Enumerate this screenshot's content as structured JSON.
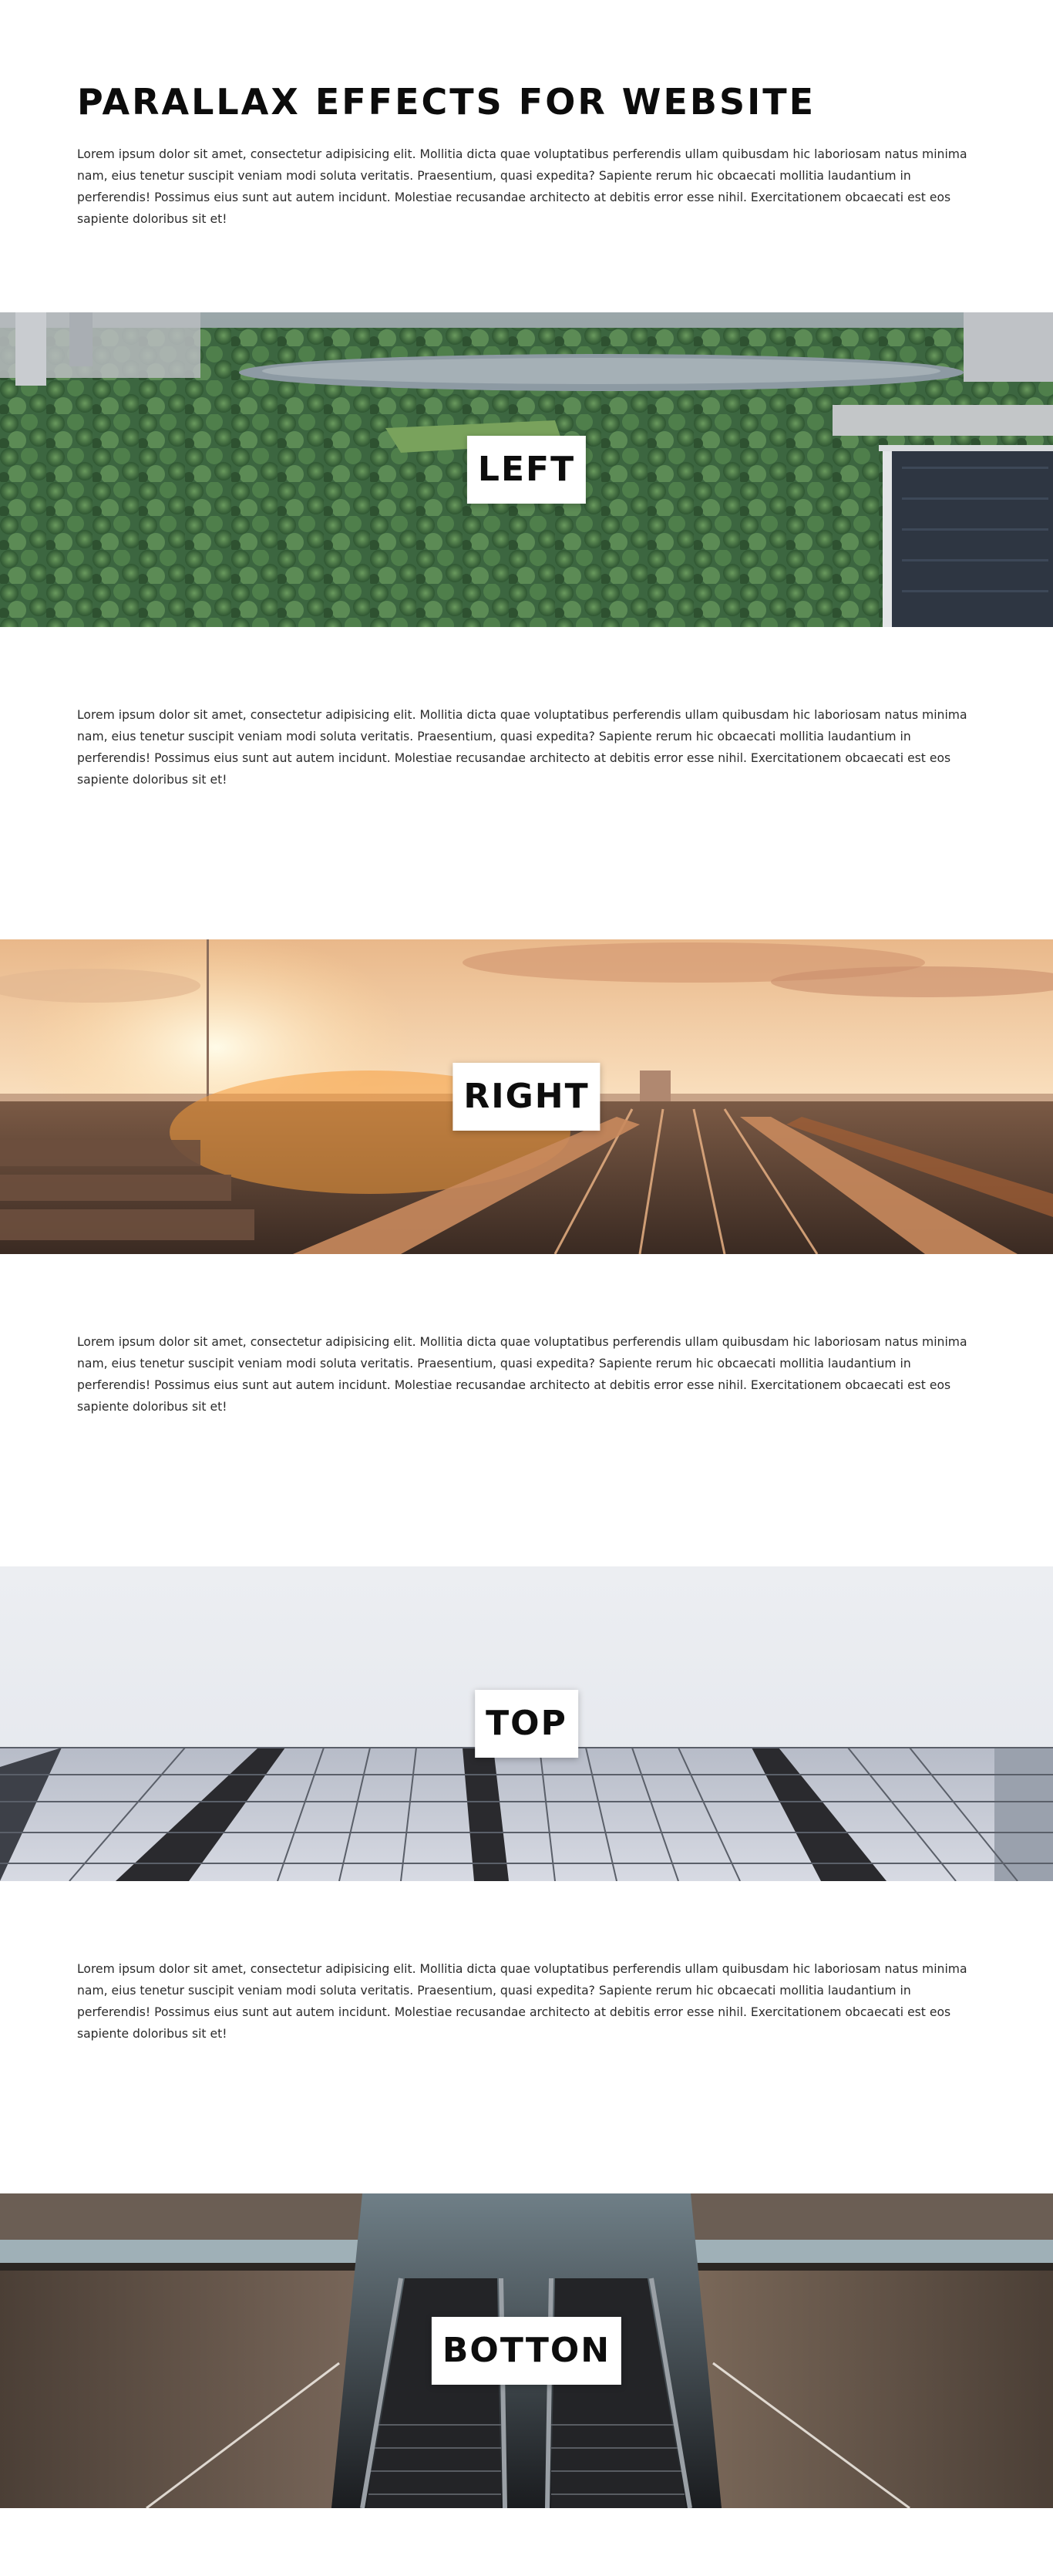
{
  "page": {
    "title": "PARALLAX EFFECTS FOR WEBSITE",
    "paragraph": "Lorem ipsum dolor sit amet, consectetur adipisicing elit. Mollitia dicta quae voluptatibus perferendis ullam quibusdam hic laboriosam natus minima nam, eius tenetur suscipit veniam modi soluta veritatis. Praesentium, quasi expedita? Sapiente rerum hic obcaecati mollitia laudantium in perferendis! Possimus eius sunt aut autem incidunt. Molestiae recusandae architecto at debitis error esse nihil. Exercitationem obcaecati est eos sapiente doloribus sit et!"
  },
  "sections": [
    {
      "label": "LEFT",
      "image": "city-park-aerial-image",
      "accent": "#3f6b3c"
    },
    {
      "label": "RIGHT",
      "image": "rail-yard-sunset-image",
      "accent": "#e98a2e"
    },
    {
      "label": "TOP",
      "image": "glass-building-sky-image",
      "accent": "#c8cdd8"
    },
    {
      "label": "BOTTON",
      "image": "escalator-station-image",
      "accent": "#3a2f28"
    }
  ],
  "paragraphs": [
    "Lorem ipsum dolor sit amet, consectetur adipisicing elit. Mollitia dicta quae voluptatibus perferendis ullam quibusdam hic laboriosam natus minima nam, eius tenetur suscipit veniam modi soluta veritatis. Praesentium, quasi expedita? Sapiente rerum hic obcaecati mollitia laudantium in perferendis! Possimus eius sunt aut autem incidunt. Molestiae recusandae architecto at debitis error esse nihil. Exercitationem obcaecati est eos sapiente doloribus sit et!",
    "Lorem ipsum dolor sit amet, consectetur adipisicing elit. Mollitia dicta quae voluptatibus perferendis ullam quibusdam hic laboriosam natus minima nam, eius tenetur suscipit veniam modi soluta veritatis. Praesentium, quasi expedita? Sapiente rerum hic obcaecati mollitia laudantium in perferendis! Possimus eius sunt aut autem incidunt. Molestiae recusandae architecto at debitis error esse nihil. Exercitationem obcaecati est eos sapiente doloribus sit et!",
    "Lorem ipsum dolor sit amet, consectetur adipisicing elit. Mollitia dicta quae voluptatibus perferendis ullam quibusdam hic laboriosam natus minima nam, eius tenetur suscipit veniam modi soluta veritatis. Praesentium, quasi expedita? Sapiente rerum hic obcaecati mollitia laudantium in perferendis! Possimus eius sunt aut autem incidunt. Molestiae recusandae architecto at debitis error esse nihil. Exercitationem obcaecati est eos sapiente doloribus sit et!"
  ]
}
